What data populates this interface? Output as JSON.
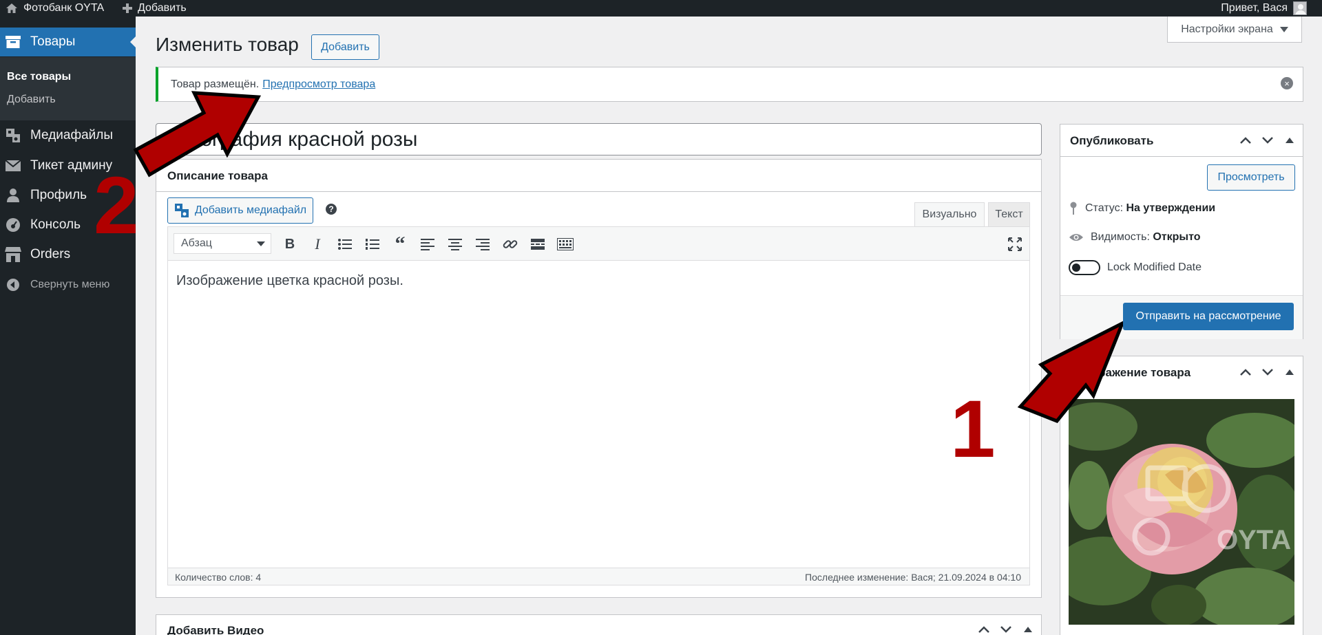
{
  "adminbar": {
    "site_name": "Фотобанк OYTA",
    "add_label": "Добавить",
    "greeting": "Привет, Вася"
  },
  "sidebar": {
    "items": [
      {
        "label": "Товары",
        "icon": "archive-icon",
        "current": true
      },
      {
        "label": "Медиафайлы",
        "icon": "media-icon"
      },
      {
        "label": "Тикет админу",
        "icon": "email-icon"
      },
      {
        "label": "Профиль",
        "icon": "user-icon"
      },
      {
        "label": "Консоль",
        "icon": "dashboard-icon"
      },
      {
        "label": "Orders",
        "icon": "store-icon"
      }
    ],
    "submenu": {
      "all": "Все товары",
      "add": "Добавить"
    },
    "collapse_label": "Свернуть меню"
  },
  "page": {
    "title": "Изменить товар",
    "add_button": "Добавить",
    "screen_options": "Настройки экрана"
  },
  "notice": {
    "text": "Товар размещён.",
    "link": "Предпросмотр товара"
  },
  "post": {
    "title_value": "Фотография красной розы"
  },
  "editor": {
    "box_title": "Описание товара",
    "add_media": "Добавить медиафайл",
    "tab_visual": "Визуально",
    "tab_text": "Текст",
    "format_select": "Абзац",
    "content": "Изображение цветка красной розы.",
    "word_count": "Количество слов: 4",
    "last_modified": "Последнее изменение: Вася; 21.09.2024 в 04:10"
  },
  "video_box": {
    "title": "Добавить Видео"
  },
  "publish": {
    "title": "Опубликовать",
    "preview_button": "Просмотреть",
    "status_label": "Статус:",
    "status_value": "На утверждении",
    "visibility_label": "Видимость:",
    "visibility_value": "Открыто",
    "lock_label": "Lock Modified Date",
    "submit_button": "Отправить на рассмотрение"
  },
  "product_image": {
    "title": "Изображение товара",
    "watermark": "OYTA"
  },
  "annotations": {
    "one": "1",
    "two": "2"
  },
  "colors": {
    "admin_dark": "#1d2327",
    "accent_blue": "#2271b1",
    "notice_green": "#00a32a",
    "annotation_red": "#b00000"
  }
}
